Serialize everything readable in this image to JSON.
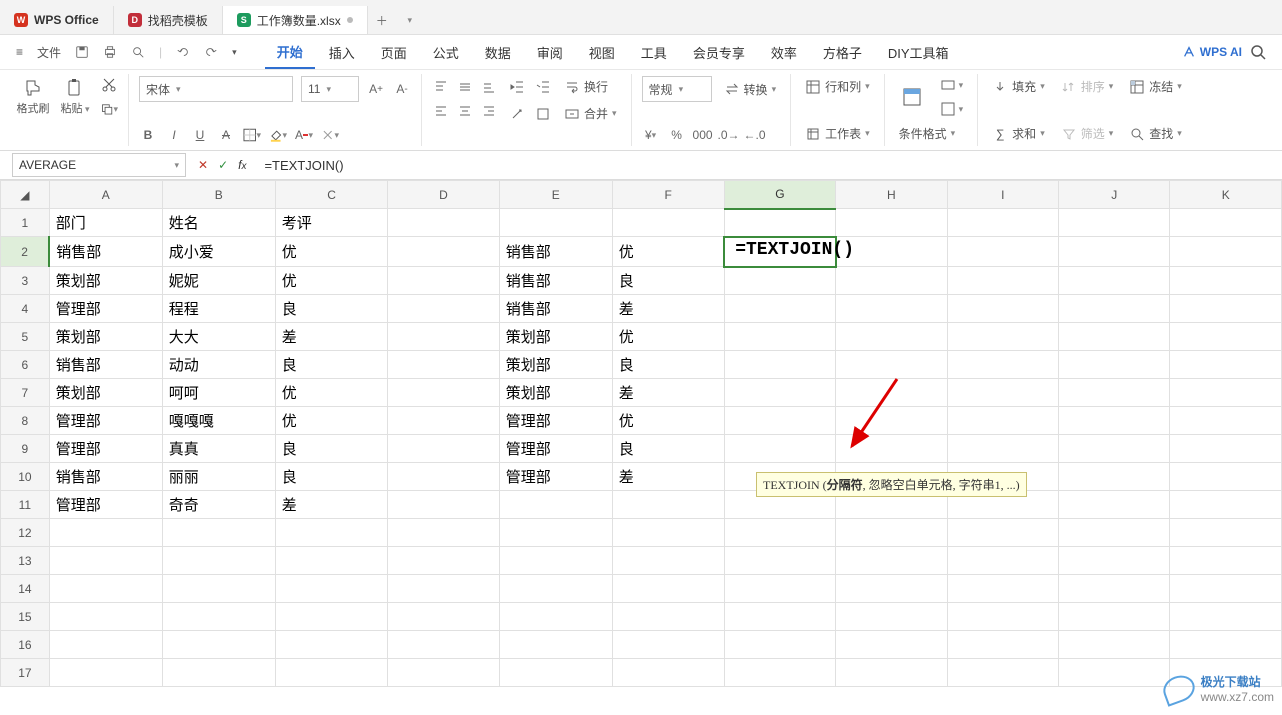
{
  "tabs": {
    "app": "WPS Office",
    "template": "找稻壳模板",
    "workbook": "工作簿数量.xlsx"
  },
  "menubar": {
    "file": "文件",
    "items": [
      "开始",
      "插入",
      "页面",
      "公式",
      "数据",
      "审阅",
      "视图",
      "工具",
      "会员专享",
      "效率",
      "方格子",
      "DIY工具箱"
    ],
    "ai": "WPS AI"
  },
  "ribbon": {
    "fmtbrush": "格式刷",
    "paste": "粘贴",
    "font": "宋体",
    "size": "11",
    "wrap": "换行",
    "merge": "合并",
    "numfmt": "常规",
    "convert": "转换",
    "rowcol": "行和列",
    "worksheet": "工作表",
    "condfmt": "条件格式",
    "fill": "填充",
    "sort": "排序",
    "freeze": "冻结",
    "sum": "求和",
    "filter": "筛选",
    "find": "查找"
  },
  "fx": {
    "name": "AVERAGE",
    "formula": "=TEXTJOIN()",
    "cell_display": "=TEXTJOIN()",
    "tooltip_fn": "TEXTJOIN",
    "tooltip_arg": "分隔符",
    "tooltip_rest": ", 忽略空白单元格, 字符串1, ...)"
  },
  "grid": {
    "cols": [
      "A",
      "B",
      "C",
      "D",
      "E",
      "F",
      "G",
      "H",
      "I",
      "J",
      "K"
    ],
    "rows": [
      {
        "n": "1",
        "c": {
          "A": "部门",
          "B": "姓名",
          "C": "考评"
        }
      },
      {
        "n": "2",
        "c": {
          "A": "销售部",
          "B": "成小爱",
          "C": "优",
          "E": "销售部",
          "F": "优"
        }
      },
      {
        "n": "3",
        "c": {
          "A": "策划部",
          "B": "妮妮",
          "C": "优",
          "E": "销售部",
          "F": "良"
        }
      },
      {
        "n": "4",
        "c": {
          "A": "管理部",
          "B": "程程",
          "C": "良",
          "E": "销售部",
          "F": "差"
        }
      },
      {
        "n": "5",
        "c": {
          "A": "策划部",
          "B": "大大",
          "C": "差",
          "E": "策划部",
          "F": "优"
        }
      },
      {
        "n": "6",
        "c": {
          "A": "销售部",
          "B": "动动",
          "C": "良",
          "E": "策划部",
          "F": "良"
        }
      },
      {
        "n": "7",
        "c": {
          "A": "策划部",
          "B": "呵呵",
          "C": "优",
          "E": "策划部",
          "F": "差"
        }
      },
      {
        "n": "8",
        "c": {
          "A": "管理部",
          "B": "嘎嘎嘎",
          "C": "优",
          "E": "管理部",
          "F": "优"
        }
      },
      {
        "n": "9",
        "c": {
          "A": "管理部",
          "B": "真真",
          "C": "良",
          "E": "管理部",
          "F": "良"
        }
      },
      {
        "n": "10",
        "c": {
          "A": "销售部",
          "B": "丽丽",
          "C": "良",
          "E": "管理部",
          "F": "差"
        }
      },
      {
        "n": "11",
        "c": {
          "A": "管理部",
          "B": "奇奇",
          "C": "差"
        }
      },
      {
        "n": "12",
        "c": {}
      },
      {
        "n": "13",
        "c": {}
      },
      {
        "n": "14",
        "c": {}
      },
      {
        "n": "15",
        "c": {}
      },
      {
        "n": "16",
        "c": {}
      },
      {
        "n": "17",
        "c": {}
      }
    ]
  },
  "watermark": {
    "name": "极光下载站",
    "url": "www.xz7.com"
  }
}
